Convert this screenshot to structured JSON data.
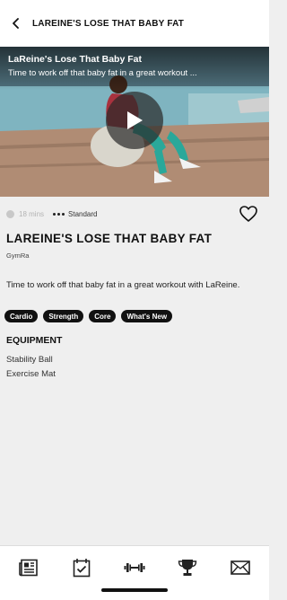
{
  "header": {
    "title": "LAREINE'S LOSE THAT BABY FAT"
  },
  "video": {
    "title": "LaReine's Lose That Baby Fat",
    "subtitle": "Time to work off that baby fat in a great workout ..."
  },
  "meta": {
    "duration": "18 mins",
    "level": "Standard"
  },
  "workout": {
    "title": "LAREINE'S LOSE THAT BABY FAT",
    "author": "GymRa",
    "description": "Time to work off that baby fat in a great workout with LaReine."
  },
  "tags": [
    "Cardio",
    "Strength",
    "Core",
    "What's New"
  ],
  "equipment": {
    "heading": "EQUIPMENT",
    "items": [
      "Stability Ball",
      "Exercise Mat"
    ]
  },
  "tabbar": {
    "icons": [
      "newspaper-icon",
      "calendar-check-icon",
      "dumbbell-icon",
      "trophy-icon",
      "mail-icon"
    ]
  }
}
